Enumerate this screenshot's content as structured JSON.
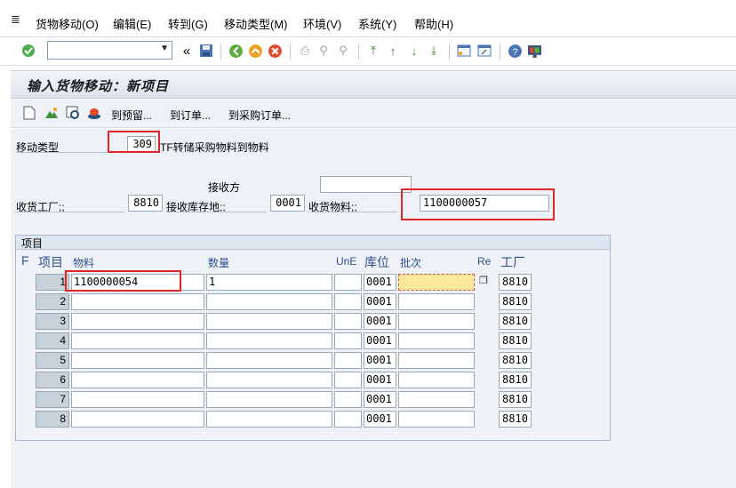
{
  "menu": {
    "items": [
      "货物移动(O)",
      "编辑(E)",
      "转到(G)",
      "移动类型(M)",
      "环境(V)",
      "系统(Y)",
      "帮助(H)"
    ]
  },
  "toolbar": {
    "command_field_value": "",
    "icons": [
      "enter-icon",
      "command-field",
      "back-double-arrow-icon",
      "save-icon",
      "back-icon",
      "exit-icon",
      "cancel-icon",
      "print-icon",
      "find-icon",
      "find-next-icon",
      "first-page-icon",
      "prev-page-icon",
      "next-page-icon",
      "last-page-icon",
      "create-session-icon",
      "shortcut-icon",
      "help-icon",
      "customize-layout-icon"
    ]
  },
  "title": "输入货物移动：新项目",
  "app_toolbar": {
    "buttons": [
      "到预留...",
      "到订单...",
      "到采购订单..."
    ]
  },
  "header": {
    "movement_type_label": "移动类型",
    "movement_type_value": "309",
    "movement_type_desc": "TF转储采购物料到物料",
    "receiver_label": "接收方",
    "receiver_value": "",
    "receiving_plant_label": "收货工厂;;",
    "receiving_plant_value": "8810",
    "receiving_sloc_label": "接收库存地;;",
    "receiving_sloc_value": "0001",
    "receiving_material_label": "收货物料;;",
    "receiving_material_value": "1100000057"
  },
  "items": {
    "group_title": "项目",
    "columns": {
      "f": "F",
      "item": "项目",
      "material": "物料",
      "quantity": "数量",
      "une": "UnE",
      "sloc": "库位",
      "batch": "批次",
      "re": "Re",
      "plant": "工厂"
    },
    "rows": [
      {
        "no": "1",
        "material": "1100000054",
        "quantity": "1",
        "une": "",
        "sloc": "0001",
        "batch": "",
        "plant": "8810"
      },
      {
        "no": "2",
        "material": "",
        "quantity": "",
        "une": "",
        "sloc": "0001",
        "batch": "",
        "plant": "8810"
      },
      {
        "no": "3",
        "material": "",
        "quantity": "",
        "une": "",
        "sloc": "0001",
        "batch": "",
        "plant": "8810"
      },
      {
        "no": "4",
        "material": "",
        "quantity": "",
        "une": "",
        "sloc": "0001",
        "batch": "",
        "plant": "8810"
      },
      {
        "no": "5",
        "material": "",
        "quantity": "",
        "une": "",
        "sloc": "0001",
        "batch": "",
        "plant": "8810"
      },
      {
        "no": "6",
        "material": "",
        "quantity": "",
        "une": "",
        "sloc": "0001",
        "batch": "",
        "plant": "8810"
      },
      {
        "no": "7",
        "material": "",
        "quantity": "",
        "une": "",
        "sloc": "0001",
        "batch": "",
        "plant": "8810"
      },
      {
        "no": "8",
        "material": "",
        "quantity": "",
        "une": "",
        "sloc": "0001",
        "batch": "",
        "plant": "8810"
      }
    ]
  },
  "colors": {
    "highlight_box": "#e0262b",
    "batch_highlight": "#fce89a",
    "column_header": "#2f4f8a"
  }
}
